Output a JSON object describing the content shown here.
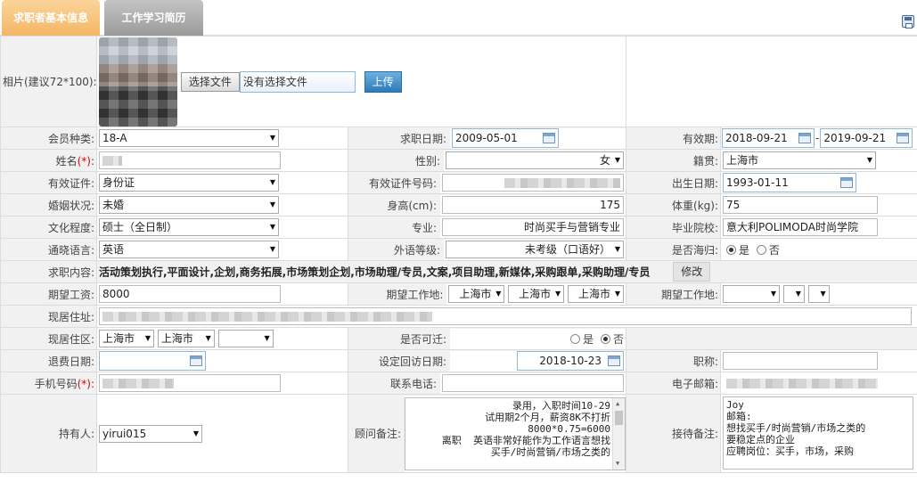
{
  "tabs": [
    "求职者基本信息",
    "工作学习简历"
  ],
  "photo": {
    "label": "相片(建议72*100):",
    "choose_file": "选择文件",
    "no_file": "没有选择文件",
    "upload": "上传"
  },
  "row1": {
    "member_type_label": "会员种类:",
    "member_type": "18-A",
    "apply_date_label": "求职日期:",
    "apply_date": "2009-05-01",
    "valid_label": "有效期:",
    "valid_from": "2018-09-21",
    "valid_dash": "-",
    "valid_to": "2019-09-21"
  },
  "row2": {
    "name_label": "姓名",
    "name_req": "(*)",
    "name_colon": ":",
    "gender_label": "性别:",
    "gender": "女",
    "origin_label": "籍贯:",
    "origin": "上海市"
  },
  "row3": {
    "id_type_label": "有效证件:",
    "id_type": "身份证",
    "id_no_label": "有效证件号码:",
    "birth_label": "出生日期:",
    "birth": "1993-01-11"
  },
  "row4": {
    "marital_label": "婚姻状况:",
    "marital": "未婚",
    "height_label": "身高(cm):",
    "height": "175",
    "weight_label": "体重(kg):",
    "weight": "75"
  },
  "row5": {
    "edu_label": "文化程度:",
    "edu": "硕士（全日制）",
    "major_label": "专业:",
    "major": "时尚买手与营销专业",
    "school_label": "毕业院校:",
    "school": "意大利POLIMODA时尚学院"
  },
  "row6": {
    "lang_label": "通晓语言:",
    "lang": "英语",
    "lang_level_label": "外语等级:",
    "lang_level": "未考级（口语好）",
    "overseas_label": "是否海归:",
    "yes": "是",
    "no": "否"
  },
  "row7": {
    "job_label": "求职内容:",
    "job_content": "活动策划执行,平面设计,企划,商务拓展,市场策划企划,市场助理/专员,文案,项目助理,新媒体,采购跟单,采购助理/专员",
    "edit": "修改"
  },
  "row8": {
    "salary_label": "期望工资:",
    "salary": "8000",
    "work_loc_label": "期望工作地:",
    "loc1": "上海市",
    "loc2": "上海市",
    "loc3": "上海市",
    "work_loc2_label": "期望工作地:"
  },
  "row9": {
    "address_label": "现居住址:"
  },
  "row10": {
    "district_label": "现居住区:",
    "d1": "上海市",
    "d2": "上海市",
    "relocate_label": "是否可迁:",
    "yes": "是",
    "no": "否"
  },
  "row11": {
    "refund_label": "退费日期:",
    "callback_label": "设定回访日期:",
    "callback": "2018-10-23",
    "title_label": "职称:"
  },
  "row12": {
    "mobile_label": "手机号码",
    "mobile_req": "(*)",
    "mobile_colon": ":",
    "phone_label": "联系电话:",
    "email_label": "电子邮箱:"
  },
  "row13": {
    "holder_label": "持有人:",
    "holder": "yirui015",
    "advisor_label": "顾问备注:",
    "advisor_note": "录用，入职时间10-29\n试用期2个月，薪资8K不打折\n8000*0.75=6000\n离职  英语非常好能作为工作语言想找\n买手/时尚营销/市场之类的",
    "reception_label": "接待备注:",
    "reception_note": "Joy\n邮箱:\n想找买手/时尚营销/市场之类的\n要稳定点的企业\n应聘岗位：买手，市场，采购"
  }
}
